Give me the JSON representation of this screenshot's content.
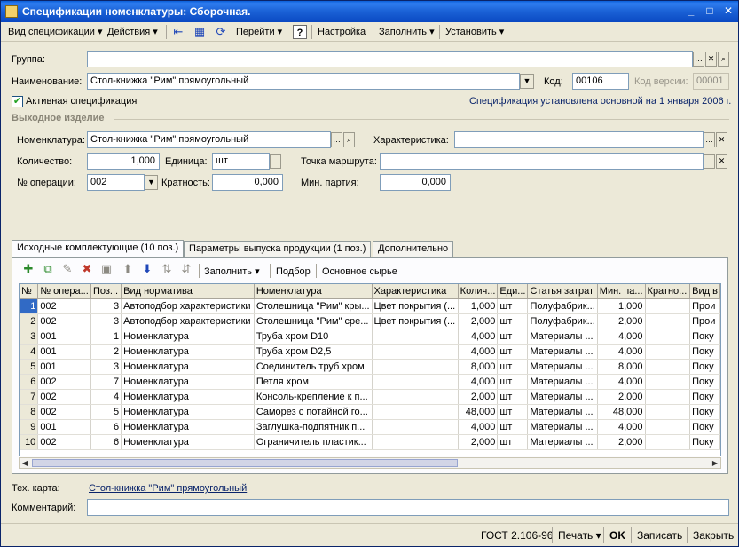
{
  "window": {
    "title": "Спецификации номенклатуры: Сборочная.",
    "minimize": "_",
    "maximize": "□",
    "close": "✕"
  },
  "toolbar": {
    "vid_spec": "Вид спецификации",
    "actions": "Действия",
    "go": "Перейти",
    "help": "?",
    "settings": "Настройка",
    "fill": "Заполнить",
    "install": "Установить"
  },
  "form": {
    "group_label": "Группа:",
    "group_value": "",
    "name_label": "Наименование:",
    "name_value": "Стол-книжка \"Рим\" прямоугольный",
    "code_label": "Код:",
    "code_value": "00106",
    "version_label": "Код версии:",
    "version_value": "00001",
    "active_label": "Активная спецификация",
    "active_checked": true,
    "spec_note": "Спецификация установлена основной на 1 января 2006 г.",
    "output_section": "Выходное изделие",
    "nomen_label": "Номенклатура:",
    "nomen_value": "Стол-книжка \"Рим\" прямоугольный",
    "char_label": "Характеристика:",
    "char_value": "",
    "qty_label": "Количество:",
    "qty_value": "1,000",
    "unit_label": "Единица:",
    "unit_value": "шт",
    "route_label": "Точка маршрута:",
    "route_value": "",
    "op_label": "№ операции:",
    "op_value": "002",
    "mult_label": "Кратность:",
    "mult_value": "0,000",
    "minbatch_label": "Мин. партия:",
    "minbatch_value": "0,000"
  },
  "tabs": [
    {
      "label": "Исходные комплектующие (10 поз.)",
      "active": true
    },
    {
      "label": "Параметры выпуска продукции (1 поз.)",
      "active": false
    },
    {
      "label": "Дополнительно",
      "active": false
    }
  ],
  "grid_toolbar": {
    "fill": "Заполнить",
    "select": "Подбор",
    "raw": "Основное сырье"
  },
  "grid": {
    "columns": [
      "№",
      "№ опера...",
      "Поз...",
      "Вид норматива",
      "Номенклатура",
      "Характеристика",
      "Колич...",
      "Еди...",
      "Статья затрат",
      "Мин. па...",
      "Кратно...",
      "Вид в"
    ],
    "rows": [
      [
        "1",
        "002",
        "3",
        "Автоподбор характеристики",
        "Столешница \"Рим\" кры...",
        "Цвет покрытия (...",
        "1,000",
        "шт",
        "Полуфабрик...",
        "1,000",
        "",
        "Прои"
      ],
      [
        "2",
        "002",
        "3",
        "Автоподбор характеристики",
        "Столешница \"Рим\" сре...",
        "Цвет покрытия (...",
        "2,000",
        "шт",
        "Полуфабрик...",
        "2,000",
        "",
        "Прои"
      ],
      [
        "3",
        "001",
        "1",
        "Номенклатура",
        "Труба хром D10",
        "",
        "4,000",
        "шт",
        "Материалы ...",
        "4,000",
        "",
        "Поку"
      ],
      [
        "4",
        "001",
        "2",
        "Номенклатура",
        "Труба хром D2,5",
        "",
        "4,000",
        "шт",
        "Материалы ...",
        "4,000",
        "",
        "Поку"
      ],
      [
        "5",
        "001",
        "3",
        "Номенклатура",
        "Соединитель труб хром",
        "",
        "8,000",
        "шт",
        "Материалы ...",
        "8,000",
        "",
        "Поку"
      ],
      [
        "6",
        "002",
        "7",
        "Номенклатура",
        "Петля хром",
        "",
        "4,000",
        "шт",
        "Материалы ...",
        "4,000",
        "",
        "Поку"
      ],
      [
        "7",
        "002",
        "4",
        "Номенклатура",
        "Консоль-крепление к п...",
        "",
        "2,000",
        "шт",
        "Материалы ...",
        "2,000",
        "",
        "Поку"
      ],
      [
        "8",
        "002",
        "5",
        "Номенклатура",
        "Саморез с потайной го...",
        "",
        "48,000",
        "шт",
        "Материалы ...",
        "48,000",
        "",
        "Поку"
      ],
      [
        "9",
        "001",
        "6",
        "Номенклатура",
        "Заглушка-подпятник п...",
        "",
        "4,000",
        "шт",
        "Материалы ...",
        "4,000",
        "",
        "Поку"
      ],
      [
        "10",
        "002",
        "6",
        "Номенклатура",
        "Ограничитель пластик...",
        "",
        "2,000",
        "шт",
        "Материалы ...",
        "2,000",
        "",
        "Поку"
      ]
    ]
  },
  "bottom": {
    "techcard_label": "Тех. карта:",
    "techcard_value": "Стол-книжка \"Рим\" прямоугольный",
    "comment_label": "Комментарий:",
    "comment_value": ""
  },
  "statusbar": {
    "gost": "ГОСТ 2.106-96",
    "print": "Печать",
    "ok": "OK",
    "save": "Записать",
    "close": "Закрыть"
  }
}
